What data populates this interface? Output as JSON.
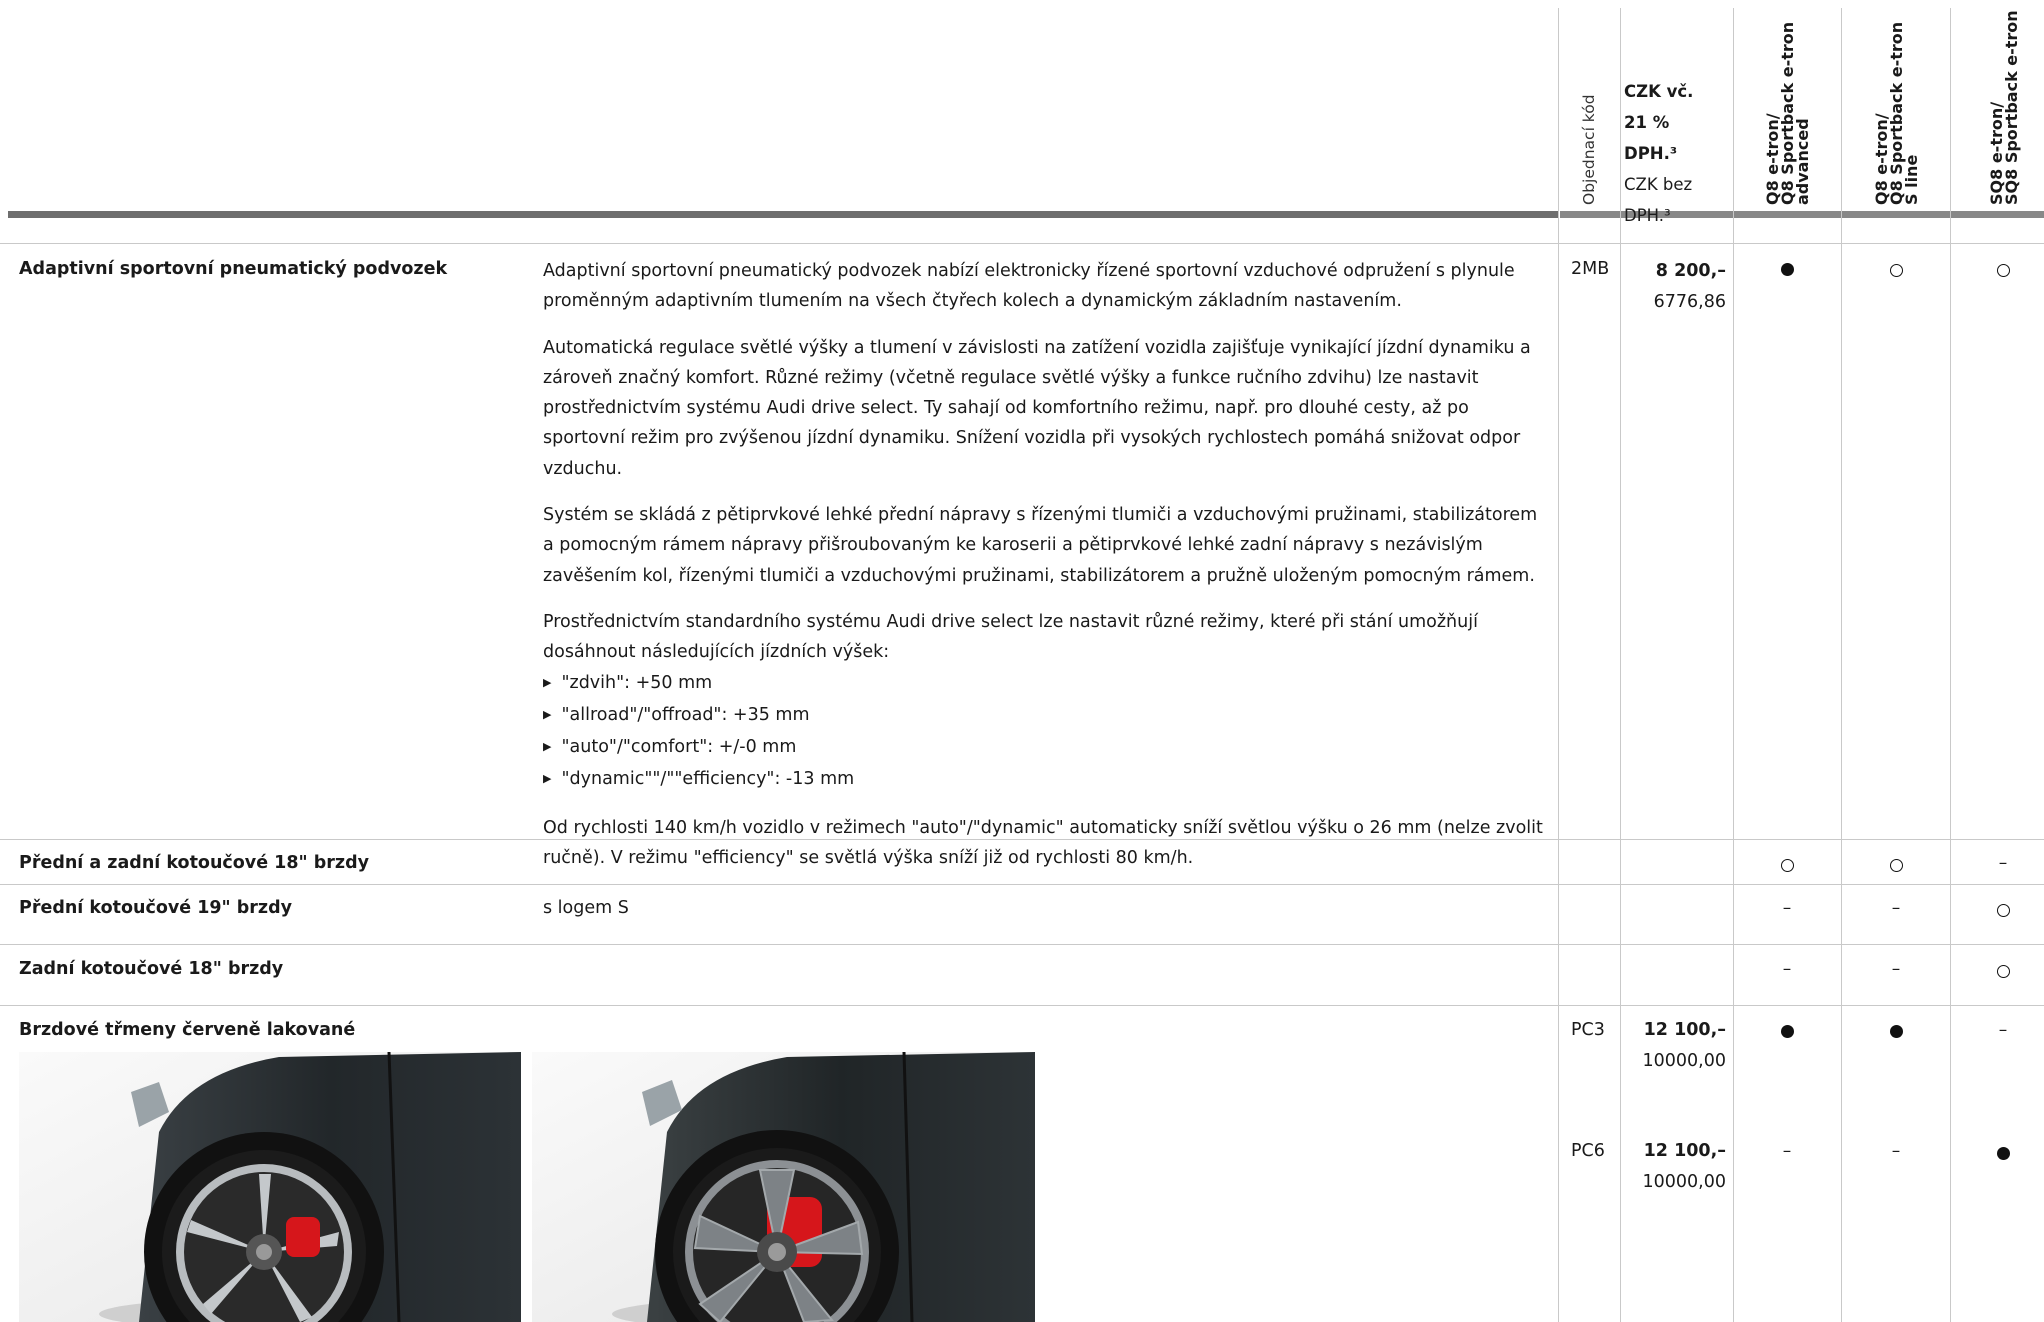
{
  "header": {
    "order_code_label": "Objednací kód",
    "price_incl_vat": "CZK vč. 21 % DPH.³",
    "price_excl_vat": "CZK bez DPH.³",
    "model_1": [
      "Q8 e-tron/",
      "Q8 Sportback e-tron",
      "advanced"
    ],
    "model_2": [
      "Q8 e-tron/",
      "Q8 Sportback e-tron",
      "S line"
    ],
    "model_3": [
      "SQ8 e-tron/",
      "SQ8 Sportback e-tron"
    ]
  },
  "rows": [
    {
      "title": "Adaptivní sportovní pneumatický podvozek",
      "paragraphs": [
        "Adaptivní sportovní pneumatický podvozek nabízí elektronicky řízené sportovní vzduchové odpružení s plynule proměnným adaptivním tlumením na všech čtyřech kolech a dynamickým základním nastavením.",
        "Automatická regulace světlé výšky a tlumení v závislosti na zatížení vozidla zajišťuje vynikající jízdní dynamiku a zároveň značný komfort. Různé režimy (včetně regulace světlé výšky a funkce ručního zdvihu) lze nastavit prostřednictvím systému Audi drive select. Ty sahají od komfortního režimu, např. pro dlouhé cesty, až po sportovní režim pro zvýšenou jízdní dynamiku. Snížení vozidla při vysokých rychlostech pomáhá snižovat odpor vzduchu.",
        "Systém se skládá z pětiprvkové lehké přední nápravy s řízenými tlumiči a vzduchovými pružinami, stabilizátorem a pomocným rámem nápravy přišroubovaným ke karoserii a pětiprvkové lehké zadní nápravy s nezávislým zavěšením kol, řízenými tlumiči a vzduchovými pružinami, stabilizátorem a pružně uloženým pomocným rámem.",
        "Prostřednictvím standardního systému Audi drive select lze nastavit různé režimy, které při stání umožňují dosáhnout následujících jízdních výšek:"
      ],
      "list": [
        "\"zdvih\": +50 mm",
        "\"allroad\"/\"offroad\": +35 mm",
        "\"auto\"/\"comfort\": +/-0 mm",
        "\"dynamic\"\"/\"\"efficiency\": -13 mm"
      ],
      "closing": "Od rychlosti 140 km/h vozidlo v režimech \"auto\"/\"dynamic\" automaticky sníží světlou výšku o 26 mm (nelze zvolit ručně). V režimu \"efficiency\" se světlá výška sníží již od rychlosti 80 km/h.",
      "code": "2MB",
      "price": "8 200,–",
      "price_net": "6776,86",
      "availability": [
        "standard",
        "optional",
        "optional"
      ]
    },
    {
      "title": "Přední a zadní kotoučové 18\" brzdy",
      "availability": [
        "optional",
        "optional",
        "–"
      ]
    },
    {
      "title": "Přední kotoučové 19\" brzdy",
      "note": "s logem S",
      "availability": [
        "–",
        "–",
        "optional"
      ]
    },
    {
      "title": "Zadní kotoučové 18\" brzdy",
      "availability": [
        "–",
        "–",
        "optional"
      ]
    },
    {
      "title": "Brzdové třmeny červeně lakované",
      "variants": [
        {
          "code": "PC3",
          "price": "12 100,–",
          "price_net": "10000,00",
          "availability": [
            "standard",
            "standard",
            "–"
          ]
        },
        {
          "code": "PC6",
          "price": "12 100,–",
          "price_net": "10000,00",
          "availability": [
            "–",
            "–",
            "standard"
          ]
        }
      ]
    }
  ],
  "images": [
    {
      "name": "car-wheel-photo-1",
      "wheel": "silver five-spoke wheel with red caliper"
    },
    {
      "name": "car-wheel-photo-2",
      "wheel": "two-tone five-spoke wheel with red caliper"
    }
  ],
  "colors": {
    "caliper": "#d6161b",
    "car_body": "#23282a",
    "rule": "#6e6e6e"
  }
}
